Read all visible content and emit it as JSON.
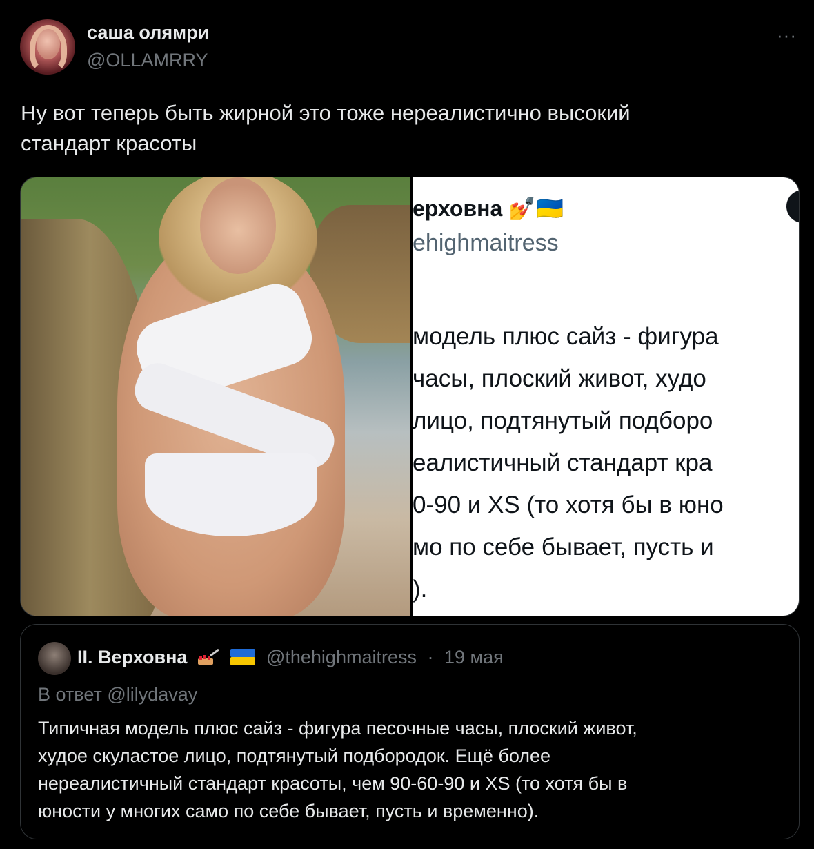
{
  "author": {
    "display_name": "саша олямри",
    "handle": "@OLLAMRRY"
  },
  "more_menu": "···",
  "tweet": {
    "text_line1": "Ну вот теперь быть жирной это тоже нереалистично высокий",
    "text_line2": "стандарт красоты"
  },
  "media": {
    "right_screenshot": {
      "name": "ерховна 💅🇺🇦",
      "handle": "ehighmaitress",
      "lines": [
        "модель плюс сайз - фигура",
        "часы, плоский живот, худо",
        "лицо, подтянутый подборо",
        "еалистичный стандарт кра",
        "0-90 и XS (то хотя бы в юно",
        "мо по себе бывает, пусть и",
        ")."
      ]
    }
  },
  "quoted": {
    "display_name": "ІІ. Верховна",
    "handle": "@thehighmaitress",
    "separator": "·",
    "date": "19 мая",
    "reply_prefix": "В ответ",
    "reply_to": "@lilydavay",
    "text_lines": [
      "Типичная модель плюс сайз - фигура песочные часы, плоский живот,",
      "худое скуластое лицо, подтянутый подбородок. Ещё более",
      "нереалистичный стандарт красоты, чем 90-60-90 и XS (то хотя бы в",
      "юности у многих само по себе бывает, пусть и временно)."
    ]
  }
}
